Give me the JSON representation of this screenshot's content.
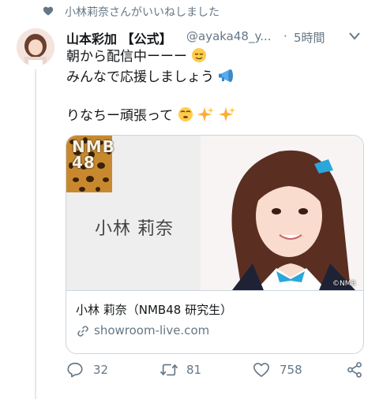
{
  "liked_banner": {
    "text": "小林莉奈さんがいいねしました"
  },
  "author": {
    "name": "山本彩加 【公式】",
    "handle": "@ayaka48_y...",
    "separator": "·",
    "time": "5時間"
  },
  "tweet": {
    "line1": "朝から配信中ーーー",
    "line2": "みんなで応援しましょう",
    "line3": "りなちー頑張って"
  },
  "card": {
    "image_logo_line1": "NMB",
    "image_logo_line2": "48",
    "image_name": "小林 莉奈",
    "image_watermark": "©NMB",
    "title": "小林 莉奈（NMB48 研究生）",
    "domain": "showroom-live.com"
  },
  "actions": {
    "reply_count": "32",
    "retweet_count": "81",
    "like_count": "758"
  },
  "colors": {
    "secondary_text": "#657786",
    "border": "#ccd6dd",
    "text": "#14171a"
  }
}
